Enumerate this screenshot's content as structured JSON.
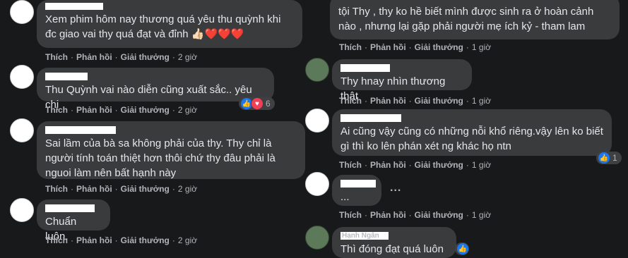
{
  "left_comments": [
    {
      "text": "Xem phim hôm nay thương quá yêu thu quỳnh khi đc giao vai thy quá đạt và đỉnh 👍🏻❤️❤️❤️",
      "actions": {
        "like": "Thích",
        "reply": "Phản hồi",
        "award": "Giải thưởng",
        "time": "2 giờ"
      }
    },
    {
      "text": "Thu Quỳnh vai nào diễn cũng xuất sắc.. yêu chị",
      "actions": {
        "like": "Thích",
        "reply": "Phản hồi",
        "award": "Giải thưởng",
        "time": "2 giờ"
      },
      "reactions": {
        "icons": [
          "like-icon",
          "love-icon"
        ],
        "count": "6"
      }
    },
    {
      "text": "Sai lầm của bà sa không phải của thy. Thy chỉ là người tính toán thiệt hơn thôi chứ thy đâu phải là nguoi làm nên bất hạnh này",
      "actions": {
        "like": "Thích",
        "reply": "Phản hồi",
        "award": "Giải thưởng",
        "time": "2 giờ"
      }
    },
    {
      "text": "Chuẩn luôn.",
      "actions": {
        "like": "Thích",
        "reply": "Phản hồi",
        "award": "Giải thưởng",
        "time": "2 giờ"
      }
    }
  ],
  "right_comments": [
    {
      "text": "tội Thy , thy ko hề biết mình được sinh ra ở hoàn cảnh nào , nhưng lại gặp phải người mẹ ích kỷ - tham lam",
      "actions": {
        "like": "Thích",
        "reply": "Phản hồi",
        "award": "Giải thưởng",
        "time": "1 giờ"
      }
    },
    {
      "text": "Thy hnay nhìn thương thật",
      "actions": {
        "like": "Thích",
        "reply": "Phản hồi",
        "award": "Giải thưởng",
        "time": "1 giờ"
      }
    },
    {
      "text": "Ai cũng vậy cũng có những nỗi khổ riêng.vậy lên ko biết gì thì ko lên phán xét ng khác họ ntn",
      "actions": {
        "like": "Thích",
        "reply": "Phản hồi",
        "award": "Giải thưởng",
        "time": "1 giờ"
      },
      "reactions": {
        "icons": [
          "like-icon"
        ],
        "count": "1"
      }
    },
    {
      "text": "...",
      "more": "...",
      "actions": {
        "like": "Thích",
        "reply": "Phản hồi",
        "award": "Giải thưởng",
        "time": "1 giờ"
      }
    },
    {
      "name_partial": "Hạnh Ngân",
      "text": "Thì đóng đạt quá luôn"
    }
  ],
  "colors": {
    "background": "#18191a",
    "bubble": "#3a3b3c",
    "text": "#e4e6eb",
    "secondary_text": "#b0b3b8",
    "like_blue": "#1877f2",
    "love_red": "#f33e58"
  }
}
